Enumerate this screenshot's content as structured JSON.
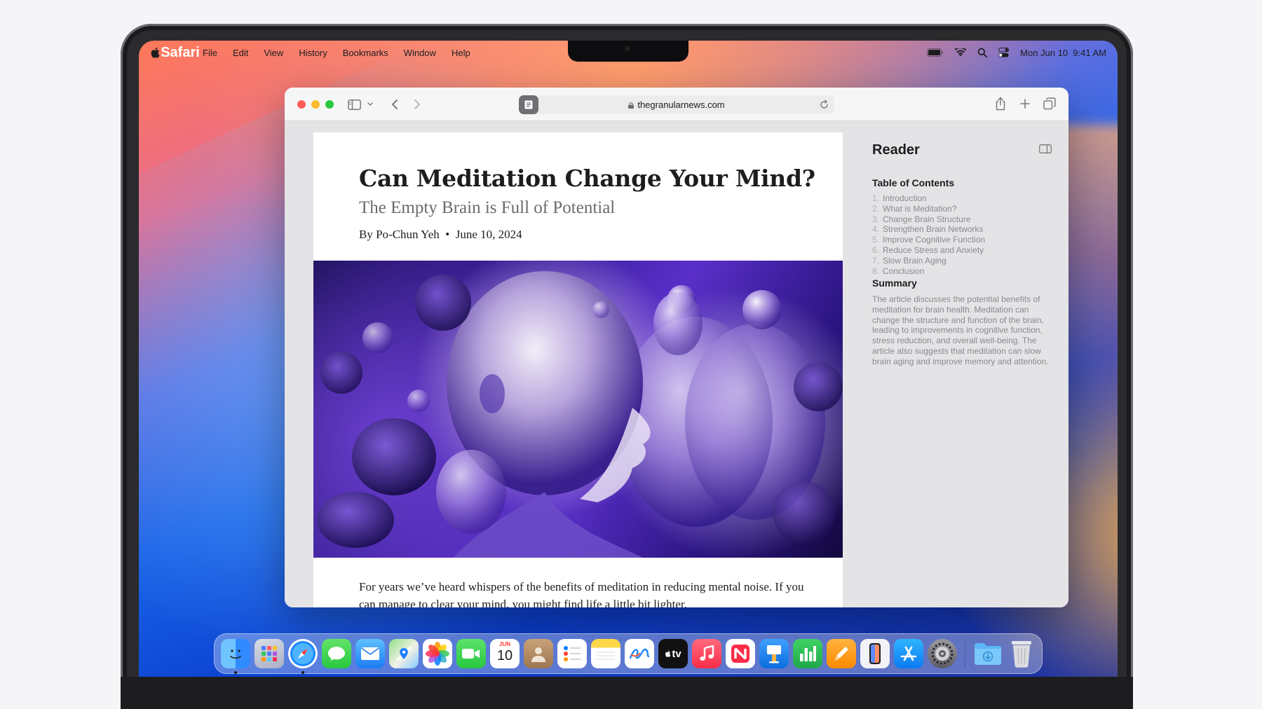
{
  "menubar": {
    "app_name": "Safari",
    "menus": [
      "File",
      "Edit",
      "View",
      "History",
      "Bookmarks",
      "Window",
      "Help"
    ],
    "clock": "Mon Jun 10  9:41 AM"
  },
  "browser": {
    "url": "thegranularnews.com"
  },
  "article": {
    "title": "Can Meditation Change Your Mind?",
    "subtitle": "The Empty Brain is Full of Potential",
    "byline": "By Po-Chun Yeh  •  June 10, 2024",
    "body": "For years we’ve heard whispers of the benefits of meditation in reducing mental noise. If you can manage to clear your mind, you might find life a little bit lighter."
  },
  "reader": {
    "title": "Reader",
    "toc_heading": "Table of Contents",
    "toc": [
      {
        "num": "1.",
        "label": "Introduction"
      },
      {
        "num": "2.",
        "label": "What is Meditation?"
      },
      {
        "num": "3.",
        "label": "Change Brain Structure"
      },
      {
        "num": "4.",
        "label": "Strengthen Brain Networks"
      },
      {
        "num": "5.",
        "label": "Improve Cognitive Function"
      },
      {
        "num": "6.",
        "label": "Reduce Stress and Anxiety"
      },
      {
        "num": "7.",
        "label": "Slow Brain Aging"
      },
      {
        "num": "8.",
        "label": "Conclusion"
      }
    ],
    "summary_heading": "Summary",
    "summary": "The article discusses the potential benefits of meditation for brain health. Meditation can change the structure and function of the brain, leading to improvements in cognitive function, stress reduction, and overall well-being. The article also suggests that meditation can slow brain aging and improve memory and attention."
  },
  "dock": {
    "calendar_month": "JUN",
    "calendar_day": "10",
    "tv_label": "tv"
  }
}
